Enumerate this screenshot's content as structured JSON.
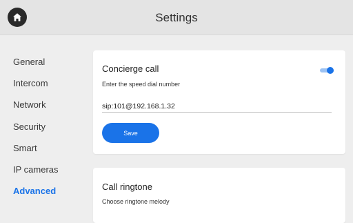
{
  "header": {
    "title": "Settings",
    "home_icon": "home-icon"
  },
  "sidebar": {
    "items": [
      {
        "label": "General"
      },
      {
        "label": "Intercom"
      },
      {
        "label": "Network"
      },
      {
        "label": "Security"
      },
      {
        "label": "Smart"
      },
      {
        "label": "IP cameras"
      },
      {
        "label": "Advanced",
        "active": true
      }
    ]
  },
  "concierge": {
    "title": "Concierge call",
    "subtitle": "Enter the speed dial number",
    "enabled": true,
    "value": "sip:101@192.168.1.32",
    "save_label": "Save"
  },
  "ringtone": {
    "title": "Call ringtone",
    "subtitle": "Choose ringtone melody"
  },
  "colors": {
    "accent": "#1a73e8",
    "header_bg": "#e4e4e4",
    "page_bg": "#eeeeee",
    "card_bg": "#ffffff"
  }
}
